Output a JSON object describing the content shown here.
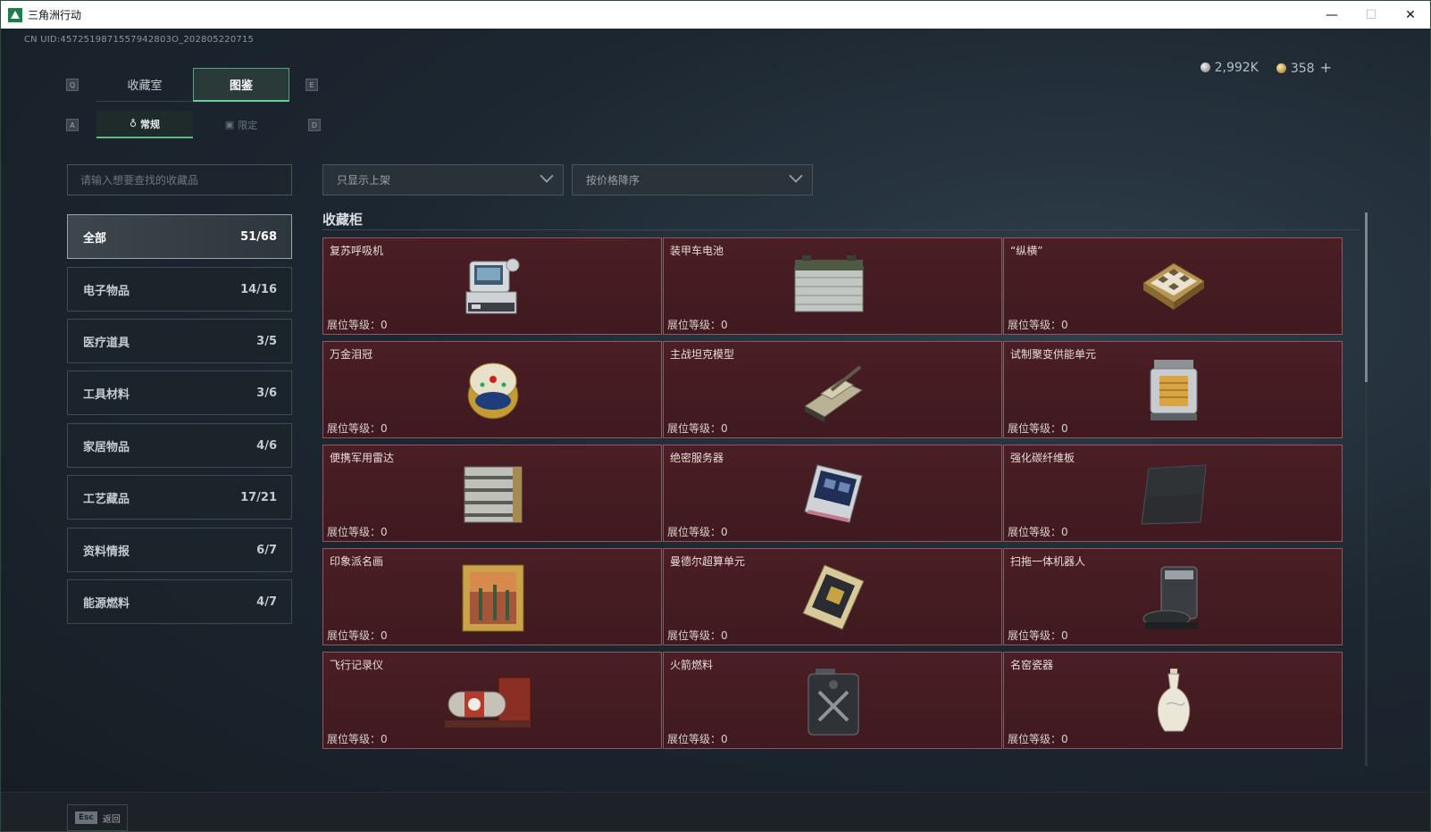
{
  "window": {
    "title": "三角洲行动",
    "minimize": "—",
    "maximize": "☐",
    "close": "✕"
  },
  "uid": "CN UID:4572519871557942803O_202805220715",
  "currency": {
    "silver": "2,992K",
    "gold": "358",
    "plus": "+"
  },
  "keys": {
    "prev_tab": "Q",
    "next_tab": "E",
    "prev_sub": "A",
    "next_sub": "D"
  },
  "tabs": [
    {
      "label": "收藏室"
    },
    {
      "label": "图鉴"
    }
  ],
  "subtabs": [
    {
      "label": "常规",
      "icon": "♁"
    },
    {
      "label": "限定",
      "icon": "▣"
    }
  ],
  "search": {
    "placeholder": "请输入想要查找的收藏品"
  },
  "filters": [
    {
      "label": "只显示上架"
    },
    {
      "label": "按价格降序"
    }
  ],
  "categories": [
    {
      "label": "全部",
      "count": "51/68"
    },
    {
      "label": "电子物品",
      "count": "14/16"
    },
    {
      "label": "医疗道具",
      "count": "3/5"
    },
    {
      "label": "工具材料",
      "count": "3/6"
    },
    {
      "label": "家居物品",
      "count": "4/6"
    },
    {
      "label": "工艺藏品",
      "count": "17/21"
    },
    {
      "label": "资料情报",
      "count": "6/7"
    },
    {
      "label": "能源燃料",
      "count": "4/7"
    }
  ],
  "section": {
    "title": "收藏柜"
  },
  "items": [
    {
      "name": "复苏呼吸机",
      "level": "展位等级：0",
      "icon": "resuscitator-icon"
    },
    {
      "name": "装甲车电池",
      "level": "展位等级：0",
      "icon": "battery-icon"
    },
    {
      "name": "“纵横”",
      "level": "展位等级：0",
      "icon": "chessboard-icon"
    },
    {
      "name": "万金泪冠",
      "level": "展位等级：0",
      "icon": "jeweled-egg-icon"
    },
    {
      "name": "主战坦克模型",
      "level": "展位等级：0",
      "icon": "tank-model-icon"
    },
    {
      "name": "试制聚变供能单元",
      "level": "展位等级：0",
      "icon": "fusion-cell-icon"
    },
    {
      "name": "便携军用雷达",
      "level": "展位等级：0",
      "icon": "radar-icon"
    },
    {
      "name": "绝密服务器",
      "level": "展位等级：0",
      "icon": "server-icon"
    },
    {
      "name": "强化碳纤维板",
      "level": "展位等级：0",
      "icon": "carbon-plate-icon"
    },
    {
      "name": "印象派名画",
      "level": "展位等级：0",
      "icon": "painting-icon"
    },
    {
      "name": "曼德尔超算单元",
      "level": "展位等级：0",
      "icon": "supercomputer-icon"
    },
    {
      "name": "扫拖一体机器人",
      "level": "展位等级：0",
      "icon": "robot-vacuum-icon"
    },
    {
      "name": "飞行记录仪",
      "level": "展位等级：0",
      "icon": "flight-recorder-icon"
    },
    {
      "name": "火箭燃料",
      "level": "展位等级：0",
      "icon": "fuel-can-icon"
    },
    {
      "name": "名窑瓷器",
      "level": "展位等级：0",
      "icon": "porcelain-vase-icon"
    }
  ],
  "bottom": {
    "esc_key": "Esc",
    "back_label": "返回"
  }
}
